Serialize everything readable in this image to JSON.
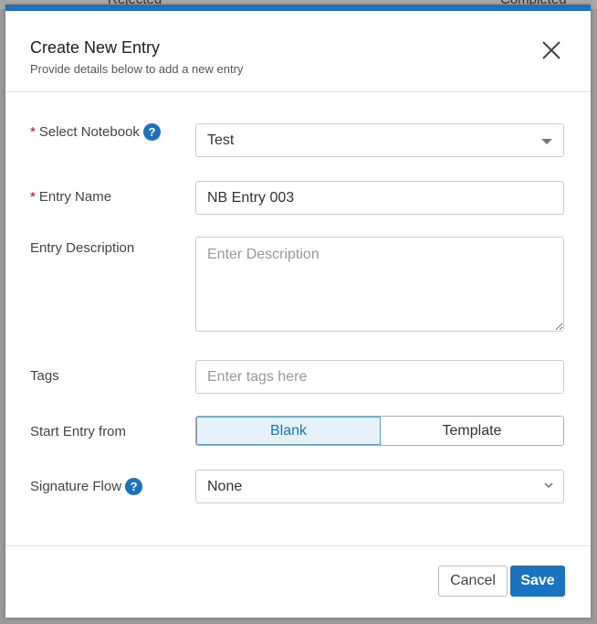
{
  "background": {
    "items": [
      "Rejected",
      "Completed"
    ]
  },
  "modal": {
    "title": "Create New Entry",
    "subtitle": "Provide details below to add a new entry"
  },
  "fields": {
    "notebook": {
      "label": "Select Notebook",
      "value": "Test"
    },
    "entry_name": {
      "label": "Entry Name",
      "value": "NB Entry 003"
    },
    "description": {
      "label": "Entry Description",
      "placeholder": "Enter Description"
    },
    "tags": {
      "label": "Tags",
      "placeholder": "Enter tags here"
    },
    "start_from": {
      "label": "Start Entry from",
      "options": [
        "Blank",
        "Template"
      ],
      "selected": "Blank"
    },
    "signature_flow": {
      "label": "Signature Flow",
      "value": "None"
    }
  },
  "required_mark": "*",
  "help_glyph": "?",
  "footer": {
    "cancel": "Cancel",
    "save": "Save"
  },
  "colors": {
    "accent": "#1a73c0",
    "required": "#d0021b"
  }
}
